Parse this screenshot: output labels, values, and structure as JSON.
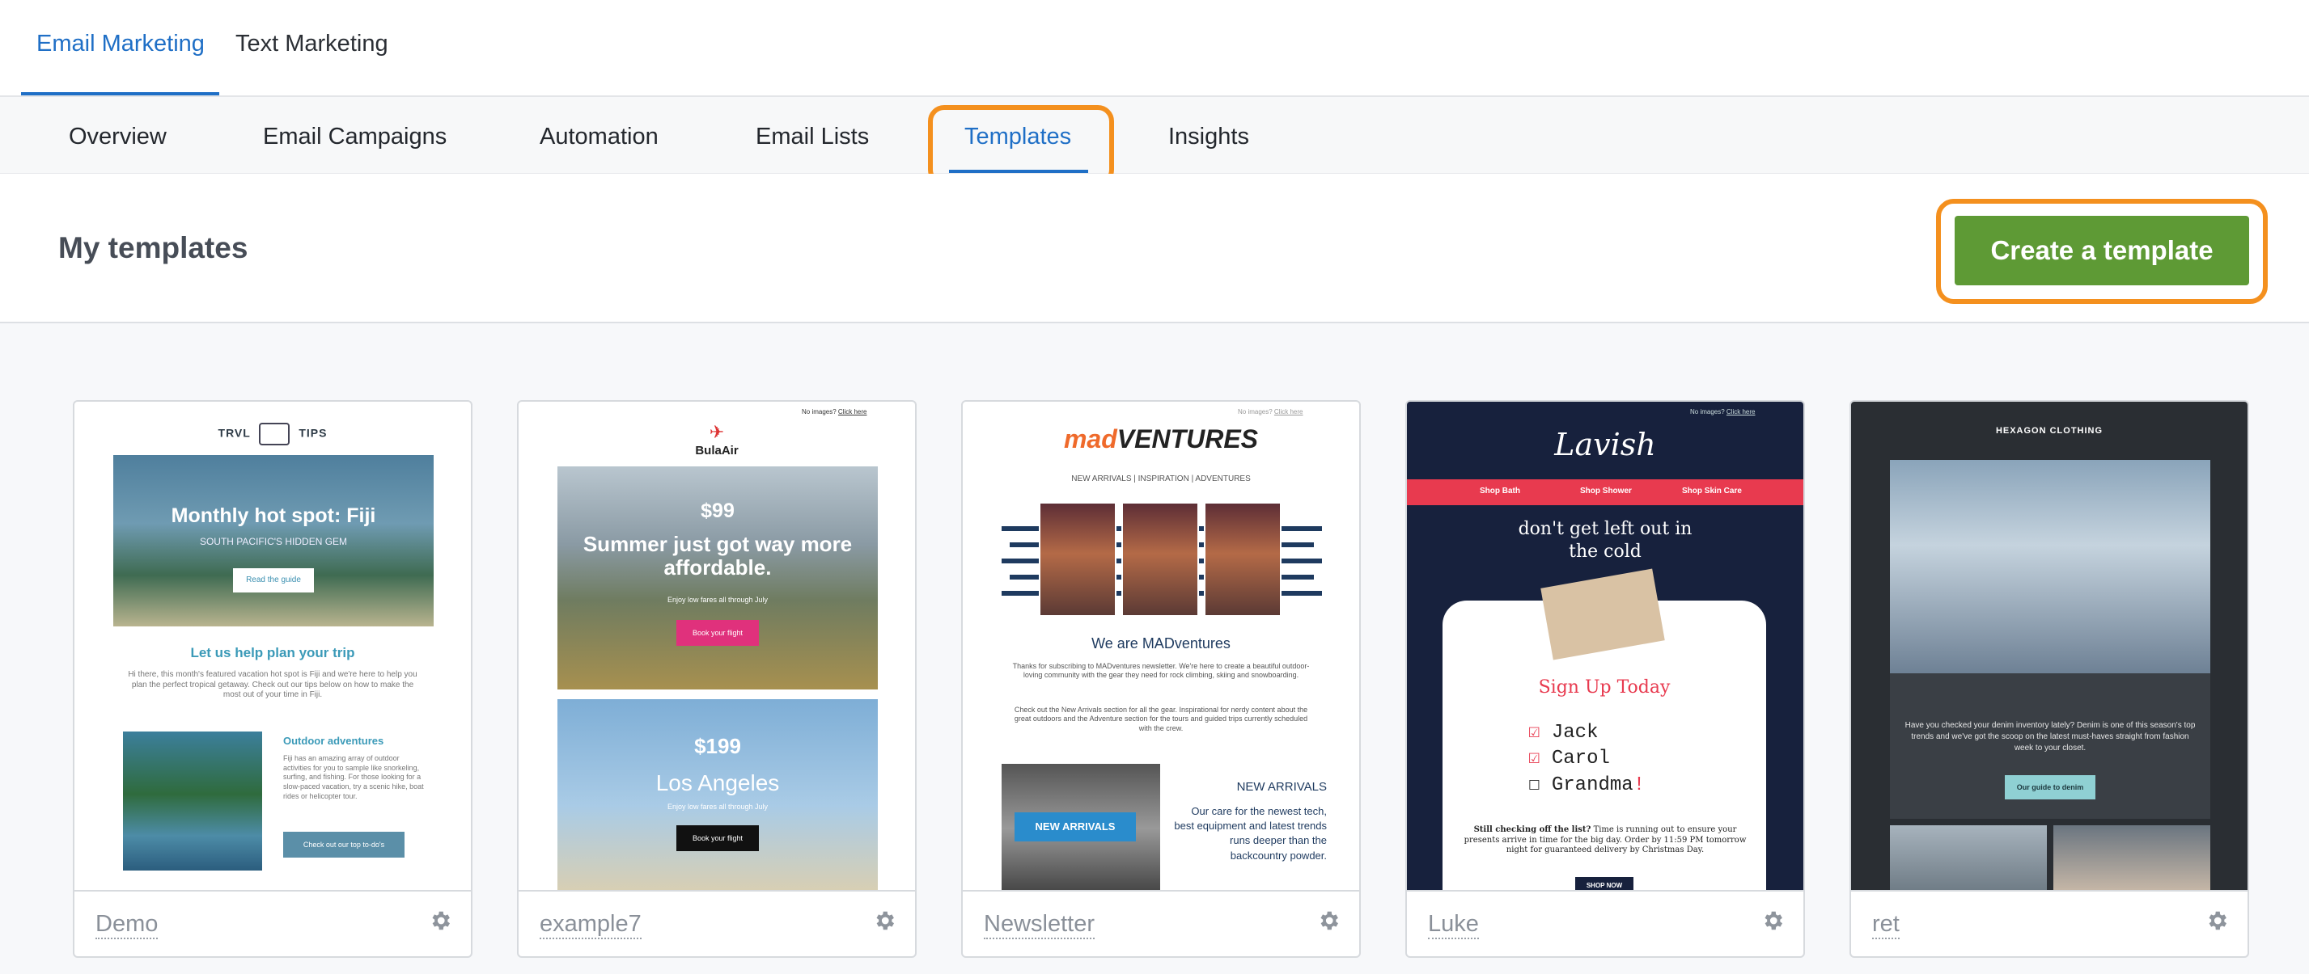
{
  "top_tabs": [
    {
      "label": "Email Marketing",
      "active": true
    },
    {
      "label": "Text Marketing",
      "active": false
    }
  ],
  "sub_nav": [
    {
      "label": "Overview"
    },
    {
      "label": "Email Campaigns"
    },
    {
      "label": "Automation"
    },
    {
      "label": "Email Lists"
    },
    {
      "label": "Templates",
      "active": true
    },
    {
      "label": "Insights"
    }
  ],
  "header": {
    "title": "My templates",
    "create_label": "Create a template"
  },
  "colors": {
    "accent": "#1f6fc6",
    "create_green": "#5e9a35",
    "highlight_orange": "#f4901e"
  },
  "templates": [
    {
      "name": "Demo",
      "preview": {
        "brand_left": "TRVL",
        "brand_right": "TIPS",
        "hero_title": "Monthly hot spot: Fiji",
        "hero_subtitle": "SOUTH PACIFIC'S HIDDEN GEM",
        "hero_button": "Read the guide",
        "heading": "Let us help plan your trip",
        "body": "Hi there, this month's featured vacation hot spot is Fiji and we're here to help you plan the perfect tropical getaway. Check out our tips below on how to make the most out of your time in Fiji.",
        "side_title": "Outdoor adventures",
        "side_body": "Fiji has an amazing array of outdoor activities for you to sample like snorkeling, surfing, and fishing. For those looking for a slow-paced vacation, try a scenic hike, boat rides or helicopter tour.",
        "side_button": "Check out our top to-do's"
      }
    },
    {
      "name": "example7",
      "preview": {
        "top_note": "No images?",
        "top_link": "Click here",
        "brand": "BulaAir",
        "price1": "$99",
        "headline1": "Summer just got way more affordable.",
        "sub1": "Enjoy low fares all through July",
        "button1": "Book your flight",
        "price2": "$199",
        "headline2": "Los Angeles",
        "sub2": "Enjoy low fares all through July",
        "button2": "Book your flight"
      }
    },
    {
      "name": "Newsletter",
      "preview": {
        "top_note": "No images?",
        "top_link": "Click here",
        "brand_a": "mad",
        "brand_b": "VENTURES",
        "nav": "NEW ARRIVALS | INSPIRATION | ADVENTURES",
        "heading": "We are MADventures",
        "body1": "Thanks for subscribing to MADventures newsletter. We're here to create a beautiful outdoor-loving community with the gear they need for rock climbing, skiing and snowboarding.",
        "body2": "Check out the New Arrivals section for all the gear. Inspirational for nerdy content about the great outdoors and the Adventure section for the tours and guided trips currently scheduled with the crew.",
        "badge": "NEW ARRIVALS",
        "side_title": "NEW ARRIVALS",
        "side_body": "Our care for the newest tech, best equipment and latest trends runs deeper than the backcountry powder."
      }
    },
    {
      "name": "Luke",
      "preview": {
        "top_note": "No images?",
        "top_link": "Click here",
        "brand": "Lavish",
        "nav": [
          "Shop Bath",
          "Shop Shower",
          "Shop Skin Care"
        ],
        "headline": "don't get left out in the cold",
        "signup": "Sign Up Today",
        "list": [
          "Jack",
          "Carol",
          "Grandma"
        ],
        "body_bold": "Still checking off the list?",
        "body": "Time is running out to ensure your presents arrive in time for the big day. Order by 11:59 PM tomorrow night for guaranteed delivery by Christmas Day.",
        "button": "SHOP NOW"
      }
    },
    {
      "name": "ret",
      "preview": {
        "brand": "HEXAGON CLOTHING",
        "body": "Have you checked your denim inventory lately? Denim is one of this season's top trends and we've got the scoop on the latest must-haves straight from fashion week to your closet.",
        "button": "Our guide to denim"
      }
    }
  ]
}
